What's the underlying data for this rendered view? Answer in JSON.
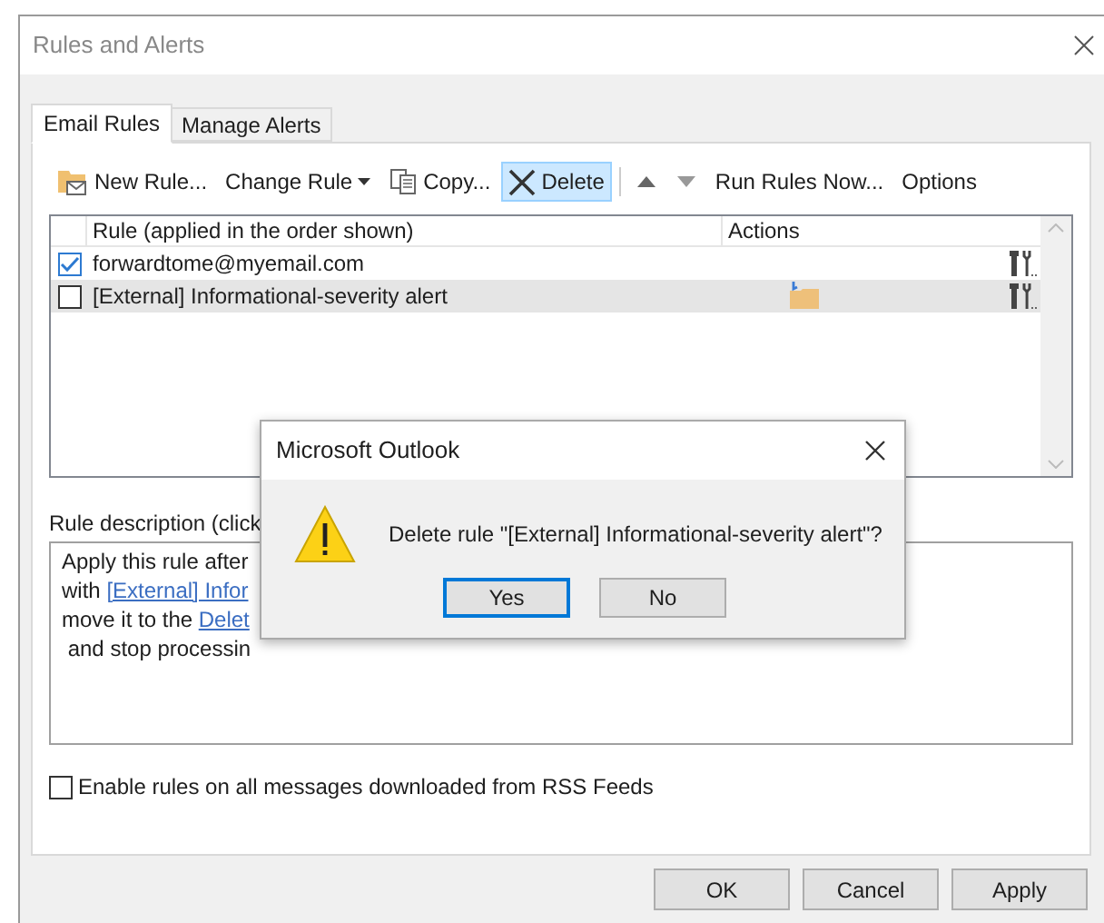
{
  "window": {
    "title": "Rules and Alerts"
  },
  "tabs": [
    {
      "label": "Email Rules",
      "selected": true
    },
    {
      "label": "Manage Alerts",
      "selected": false
    }
  ],
  "toolbar": [
    {
      "kind": "new",
      "label": "New Rule...",
      "highlighted": false
    },
    {
      "kind": "dropdown",
      "label": "Change Rule",
      "highlighted": false
    },
    {
      "kind": "copy",
      "label": "Copy...",
      "highlighted": false
    },
    {
      "kind": "delete",
      "label": "Delete",
      "highlighted": true
    },
    {
      "kind": "up"
    },
    {
      "kind": "down"
    },
    {
      "kind": "text",
      "label": "Run Rules Now...",
      "highlighted": false
    },
    {
      "kind": "text",
      "label": "Options",
      "highlighted": false
    }
  ],
  "rules_table": {
    "columns": [
      "Rule (applied in the order shown)",
      "Actions"
    ],
    "rows": [
      {
        "name": "forwardtome@myemail.com",
        "checked": true,
        "selected": false,
        "move_to_folder": false
      },
      {
        "name": "[External] Informational-severity alert",
        "checked": false,
        "selected": true,
        "move_to_folder": true
      }
    ]
  },
  "description": {
    "label": "Rule description (click",
    "lines": [
      [
        {
          "text": "Apply this rule after",
          "link": false
        }
      ],
      [
        {
          "text": "with ",
          "link": false
        },
        {
          "text": "[External] Infor",
          "link": true
        }
      ],
      [
        {
          "text": "move it to the ",
          "link": false
        },
        {
          "text": "Delet",
          "link": true
        }
      ],
      [
        {
          "text": " and stop processin",
          "link": false
        }
      ]
    ]
  },
  "rss_checkbox": {
    "label": "Enable rules on all messages downloaded from RSS Feeds",
    "checked": false
  },
  "buttons": [
    "OK",
    "Cancel",
    "Apply"
  ],
  "message_box": {
    "title": "Microsoft Outlook",
    "message": "Delete rule \"[External] Informational-severity alert\"?",
    "buttons": [
      {
        "label": "Yes",
        "selected": true
      },
      {
        "label": "No",
        "selected": false
      }
    ]
  }
}
